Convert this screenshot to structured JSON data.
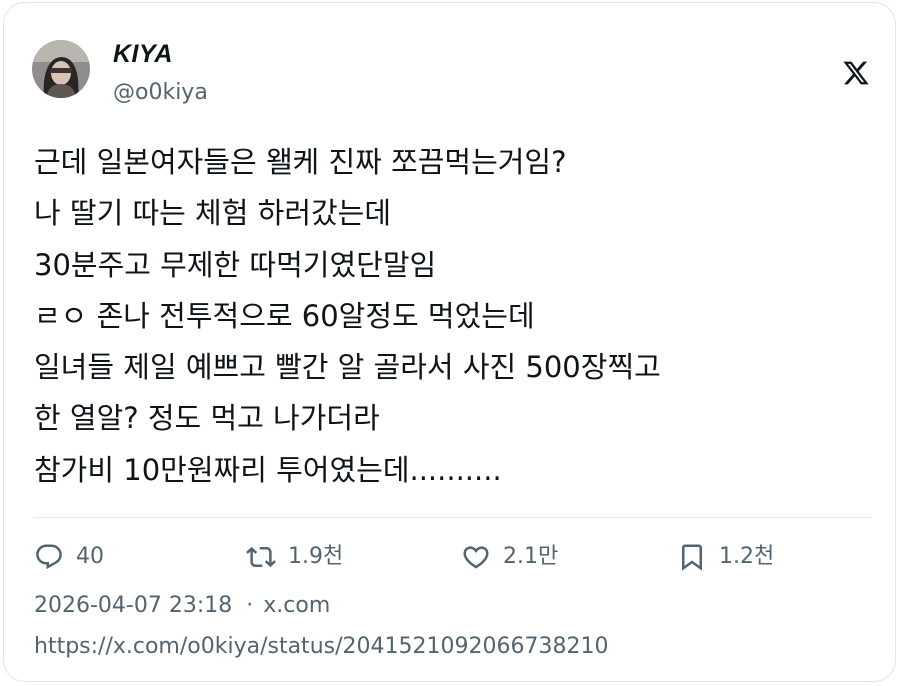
{
  "author": {
    "display_name": "KIYA",
    "handle": "@o0kiya",
    "avatar_icon": "user-avatar"
  },
  "brand_icon": "x-logo-icon",
  "tweet": {
    "lines": [
      "근데 일본여자들은 왤케 진짜 쪼끔먹는거임?",
      "나 딸기 따는 체험 하러갔는데",
      "30분주고 무제한 따먹기였단말임",
      "ㄹㅇ 존나 전투적으로 60알정도 먹었는데",
      "일녀들 제일 예쁘고 빨간 알 골라서 사진 500장찍고",
      "한 열알? 정도 먹고 나가더라",
      "참가비 10만원짜리 투어였는데.........."
    ]
  },
  "actions": {
    "replies": "40",
    "retweets": "1.9천",
    "likes": "2.1만",
    "bookmarks": "1.2천"
  },
  "meta": {
    "timestamp": "2026-04-07 23:18",
    "separator": "·",
    "source": "x.com"
  },
  "status_url": "https://x.com/o0kiya/status/2041521092066738210",
  "colors": {
    "text": "#0f1419",
    "secondary": "#536471",
    "border": "#e1e4e8"
  }
}
